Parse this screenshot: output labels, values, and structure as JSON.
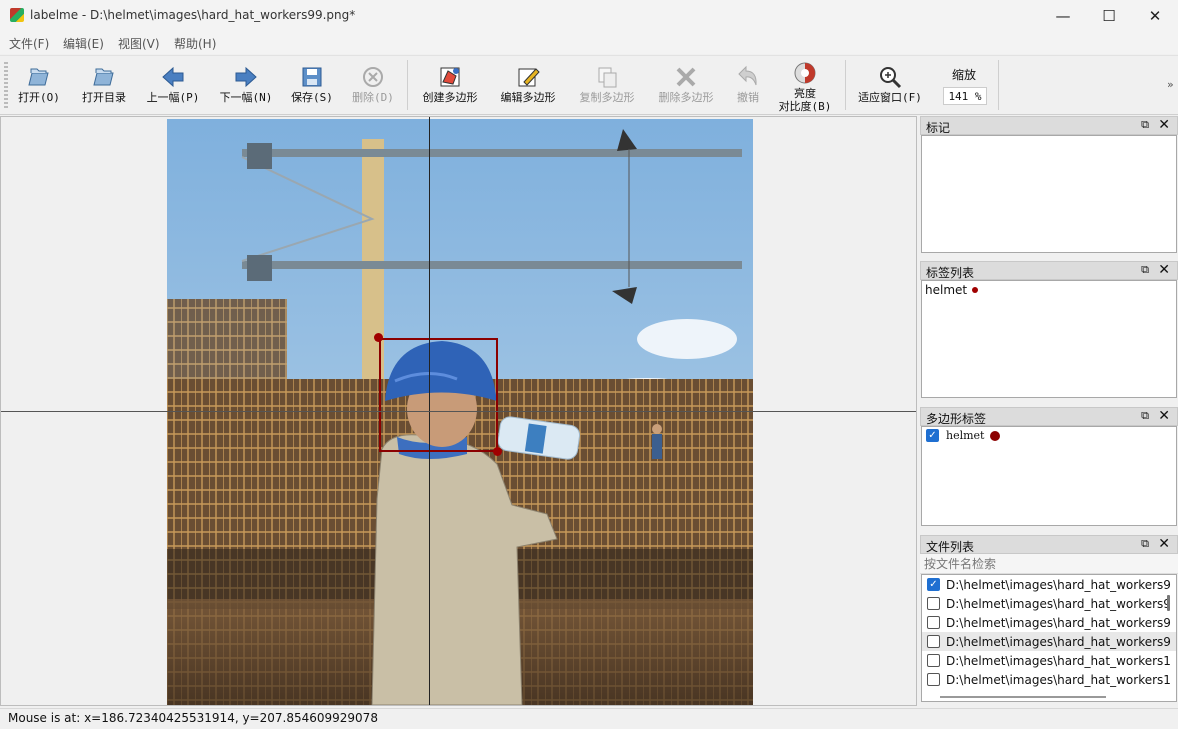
{
  "window": {
    "title": "labelme - D:\\helmet\\images\\hard_hat_workers99.png*",
    "minimize": "—",
    "maximize": "☐",
    "close": "✕"
  },
  "menu": [
    "文件(F)",
    "编辑(E)",
    "视图(V)",
    "帮助(H)"
  ],
  "toolbar": {
    "open": "打开(O)",
    "open_dir": "打开目录",
    "prev": "上一幅(P)",
    "next": "下一幅(N)",
    "save": "保存(S)",
    "delete": "删除(D)",
    "create_poly": "创建多边形",
    "edit_poly": "编辑多边形",
    "copy_poly": "复制多边形",
    "delete_poly": "删除多边形",
    "undo": "撤销",
    "brightness_line1": "亮度",
    "brightness_line2": "对比度(B)",
    "fit_window": "适应窗口(F)",
    "zoom_label": "缩放",
    "zoom_value": "141 %",
    "more": "»"
  },
  "docks": {
    "flags_title": "标记",
    "label_list_title": "标签列表",
    "label_list_items": [
      "helmet"
    ],
    "polygon_title": "多边形标签",
    "polygon_items": [
      "helmet"
    ],
    "files_title": "文件列表",
    "files_search_placeholder": "按文件名检索",
    "files": [
      {
        "name": "D:\\helmet\\images\\hard_hat_workers9",
        "checked": true
      },
      {
        "name": "D:\\helmet\\images\\hard_hat_workers9",
        "checked": false
      },
      {
        "name": "D:\\helmet\\images\\hard_hat_workers9",
        "checked": false
      },
      {
        "name": "D:\\helmet\\images\\hard_hat_workers9",
        "checked": false
      },
      {
        "name": "D:\\helmet\\images\\hard_hat_workers1",
        "checked": false
      },
      {
        "name": "D:\\helmet\\images\\hard_hat_workers1",
        "checked": false
      }
    ],
    "float_glyph": "⧉",
    "close_glyph": "✕"
  },
  "status": "Mouse is at: x=186.72340425531914, y=207.854609929078",
  "colors": {
    "accent": "#1f6fd1",
    "shape": "#8b0000"
  }
}
